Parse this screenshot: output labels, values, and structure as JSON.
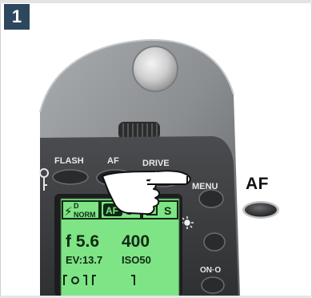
{
  "step": {
    "number": "1"
  },
  "camera": {
    "button_labels": {
      "flash": "FLASH",
      "af": "AF",
      "drive": "DRIVE",
      "menu": "MENU",
      "on_off": "ON·O"
    },
    "lcd": {
      "mode_norm": "NORM",
      "mode_d": "D",
      "af_badge": "AF",
      "af_mode": "S",
      "drive_mode": "S",
      "aperture": "f 5.6",
      "shutter": "400",
      "ev": "EV:13.7",
      "iso": "ISO50"
    }
  },
  "callout": {
    "label": "AF"
  },
  "colors": {
    "step_badge": "#2d475f",
    "lcd_background": "#7fe486",
    "camera_body": "#8a8d90",
    "button_dark": "#3a3b3d"
  }
}
